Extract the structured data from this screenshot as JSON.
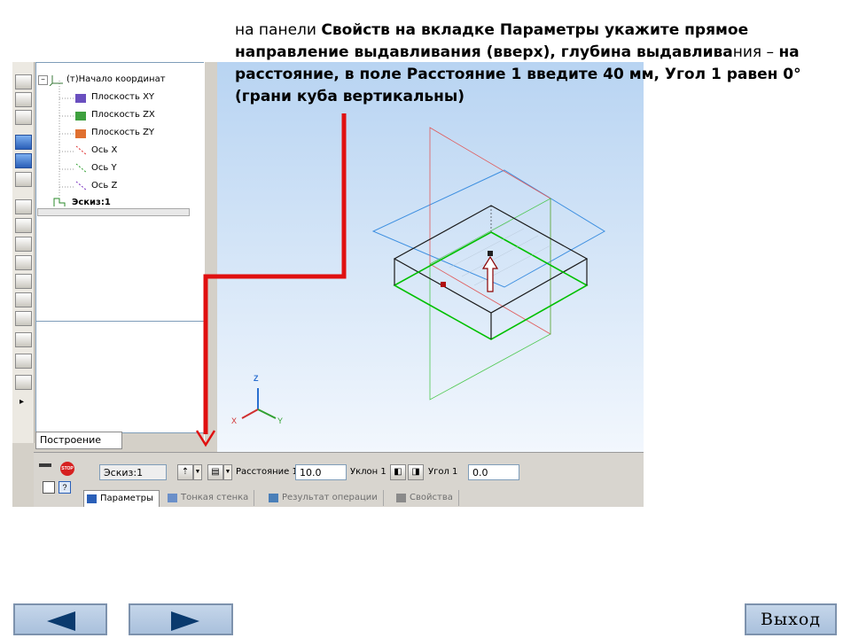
{
  "instruction": {
    "part1": "на панели ",
    "part2": "Свойств на вкладке Параметры укажите прямое направление выдавливания (вверх), глубина выдавлива",
    "part3": "ния – ",
    "part4": "на расстояние, в поле Расстояние 1 введите 40 мм, Угол 1 равен 0° (грани куба вертикальны)"
  },
  "tree": {
    "origin": "(т)Начало координат",
    "items": [
      "Плоскость XY",
      "Плоскость ZX",
      "Плоскость ZY",
      "Ось X",
      "Ось Y",
      "Ось Z"
    ],
    "sketch": "Эскиз:1",
    "tab_label": "Построение"
  },
  "viewport": {
    "axis_z": "Z",
    "axis_x": "X",
    "axis_y": "Y",
    "colors": {
      "plane_blue": "#3d8fe0",
      "plane_red": "#e05a5a",
      "plane_green": "#3ec43e",
      "sketch_green": "#00c000",
      "edges": "#000000"
    }
  },
  "properties": {
    "sketch_field": "Эскиз:1",
    "distance_label": "Расстояние 1",
    "distance_value": "10.0",
    "slope_label": "Уклон 1",
    "angle_label": "Угол 1",
    "angle_value": "0.0",
    "stop_label": "STOP",
    "tabs": [
      "Параметры",
      "Тонкая стенка",
      "Результат операции",
      "Свойства"
    ]
  },
  "navigation": {
    "prev": "previous-arrow-icon",
    "next": "next-arrow-icon",
    "exit_label": "Выход"
  },
  "colors": {
    "pointer_red": "#e01010",
    "nav_arrow": "#0a3a6e"
  }
}
